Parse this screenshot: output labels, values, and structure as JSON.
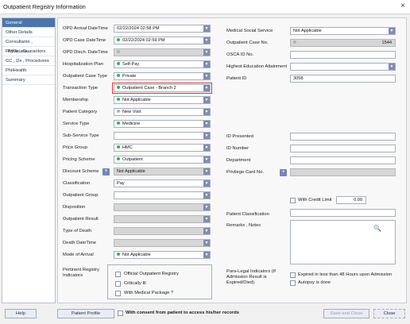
{
  "window": {
    "title": "Outpatient Registry Information",
    "close_glyph": "×"
  },
  "sidebar": [
    {
      "label": "General"
    },
    {
      "label": "Other Details"
    },
    {
      "label": "Consultants , Physicians"
    },
    {
      "label": "HMOs , Guarantors"
    },
    {
      "label": "CC , Dx , Procedures"
    },
    {
      "label": "PhilHealth"
    },
    {
      "label": "Summary"
    }
  ],
  "left": [
    {
      "label": "OPD Arrival DateTime",
      "value": "02/22/2024 02:58 PM",
      "dot": "",
      "dropdown": true,
      "disabled": false,
      "highlight": false
    },
    {
      "label": "OPD Case DateTime",
      "value": "02/22/2024 02:59 PM",
      "dot": "green",
      "dropdown": true,
      "disabled": false,
      "highlight": false
    },
    {
      "label": "OPD Disch. DateTime",
      "value": "",
      "dot": "gray",
      "dropdown": true,
      "disabled": true,
      "highlight": false
    },
    {
      "label": "Hospitalization Plan",
      "value": "Self-Pay",
      "dot": "green",
      "dropdown": true,
      "disabled": false,
      "highlight": false
    },
    {
      "label": "Outpatient Case Type",
      "value": "Private",
      "dot": "green",
      "dropdown": true,
      "disabled": false,
      "highlight": false
    },
    {
      "label": "Transaction Type",
      "value": "Outpatient Case - Branch 2",
      "dot": "green",
      "dropdown": true,
      "disabled": false,
      "highlight": true
    },
    {
      "label": "Membership",
      "value": "Not Applicable",
      "dot": "green",
      "dropdown": true,
      "disabled": false,
      "highlight": false
    },
    {
      "label": "Patient Category",
      "value": "New Visit",
      "dot": "gray",
      "dropdown": true,
      "disabled": false,
      "highlight": false
    },
    {
      "label": "Service Type",
      "value": "Medicine",
      "dot": "green",
      "dropdown": true,
      "disabled": false,
      "highlight": false
    },
    {
      "label": "Sub-Service Type",
      "value": "",
      "dot": "",
      "dropdown": true,
      "disabled": false,
      "highlight": false
    },
    {
      "label": "Price Group",
      "value": "HMC",
      "dot": "green",
      "dropdown": true,
      "disabled": false,
      "highlight": false
    },
    {
      "label": "Pricing Scheme",
      "value": "Outpatient",
      "dot": "green",
      "dropdown": true,
      "disabled": false,
      "highlight": false
    },
    {
      "label": "Discount Scheme",
      "value": "Not Applicable",
      "dot": "",
      "dropdown": true,
      "disabled": true,
      "highlight": false,
      "plus": true
    },
    {
      "label": "Classification",
      "value": "Pay",
      "dot": "",
      "dropdown": true,
      "disabled": false,
      "highlight": false
    },
    {
      "label": "Outpatient Group",
      "value": "",
      "dot": "",
      "dropdown": true,
      "disabled": false,
      "highlight": false
    },
    {
      "label": "Disposition",
      "value": "",
      "dot": "",
      "dropdown": true,
      "disabled": true,
      "highlight": false
    },
    {
      "label": "Outpatient Result",
      "value": "",
      "dot": "",
      "dropdown": true,
      "disabled": true,
      "highlight": false
    },
    {
      "label": "Type of Death",
      "value": "",
      "dot": "",
      "dropdown": true,
      "disabled": true,
      "highlight": false
    },
    {
      "label": "Death DateTime",
      "value": "",
      "dot": "",
      "dropdown": true,
      "disabled": true,
      "highlight": false
    },
    {
      "label": "Mode of Arrival",
      "value": "Not Applicable",
      "dot": "green",
      "dropdown": true,
      "disabled": false,
      "highlight": false
    }
  ],
  "right_top": [
    {
      "label": "Medical Social Service",
      "value": "Not Applicable",
      "dropdown": true,
      "disabled": false
    },
    {
      "label": "Outpatient Case No.",
      "value": "",
      "right_value": "1544",
      "dot": "gray",
      "dropdown": false,
      "disabled": true
    },
    {
      "label": "OSCA ID No.",
      "value": "",
      "dropdown": false,
      "disabled": false
    },
    {
      "label": "Highest Education Attainment",
      "value": "",
      "dropdown": true,
      "disabled": false
    },
    {
      "label": "Patient ID",
      "value": "3058",
      "dropdown": false,
      "disabled": false
    }
  ],
  "right_mid": [
    {
      "label": "ID Presented",
      "disabled": false
    },
    {
      "label": "ID Number",
      "disabled": false
    },
    {
      "label": "Department",
      "disabled": false
    },
    {
      "label": "Privilege Card No.",
      "disabled": true
    }
  ],
  "credit": {
    "label": "With Credit Limit",
    "value": "0.00"
  },
  "patient_classification": {
    "label": "Patient Classification"
  },
  "remarks": {
    "label": "Remarks , Notes"
  },
  "registry": {
    "label": "Pertinent Registry Indicators",
    "options": [
      "Official Outpatient Registry",
      "Critically Ill",
      "With Medical Package ?"
    ]
  },
  "paralegal": {
    "label": "Para-Legal Indicators (If Admission Result is Expired/Died)",
    "options": [
      "Expired in less than 48 Hours upon Admission",
      "Autopsy is done"
    ]
  },
  "footer": {
    "help": "Help",
    "profile": "Patient Profile",
    "consent": "With consent from patient to access his/her records",
    "save": "Save and Close",
    "close": "Close"
  }
}
